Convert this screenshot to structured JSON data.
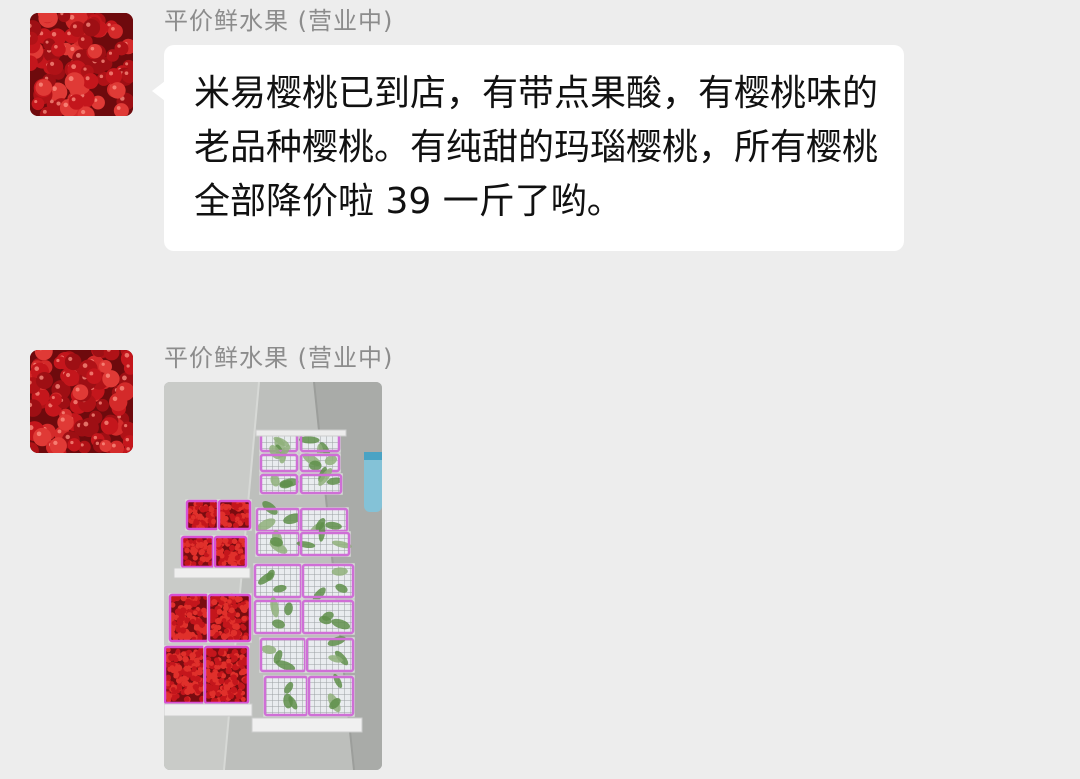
{
  "messages": [
    {
      "sender": "平价鲜水果 (营业中)",
      "type": "text",
      "text": "米易樱桃已到店，有带点果酸，有樱桃味的老品种樱桃。有纯甜的玛瑙樱桃，所有樱桃全部降价啦 39 一斤了哟。"
    },
    {
      "sender": "平价鲜水果 (营业中)",
      "type": "image"
    }
  ],
  "colors": {
    "chat_background": "#ededed",
    "bubble": "#ffffff",
    "sender_name": "#8c8c8c",
    "cherry_red": "#c4161c"
  },
  "icons": {
    "avatar": "cherries-avatar",
    "photo": "cherry-crates-photo"
  }
}
